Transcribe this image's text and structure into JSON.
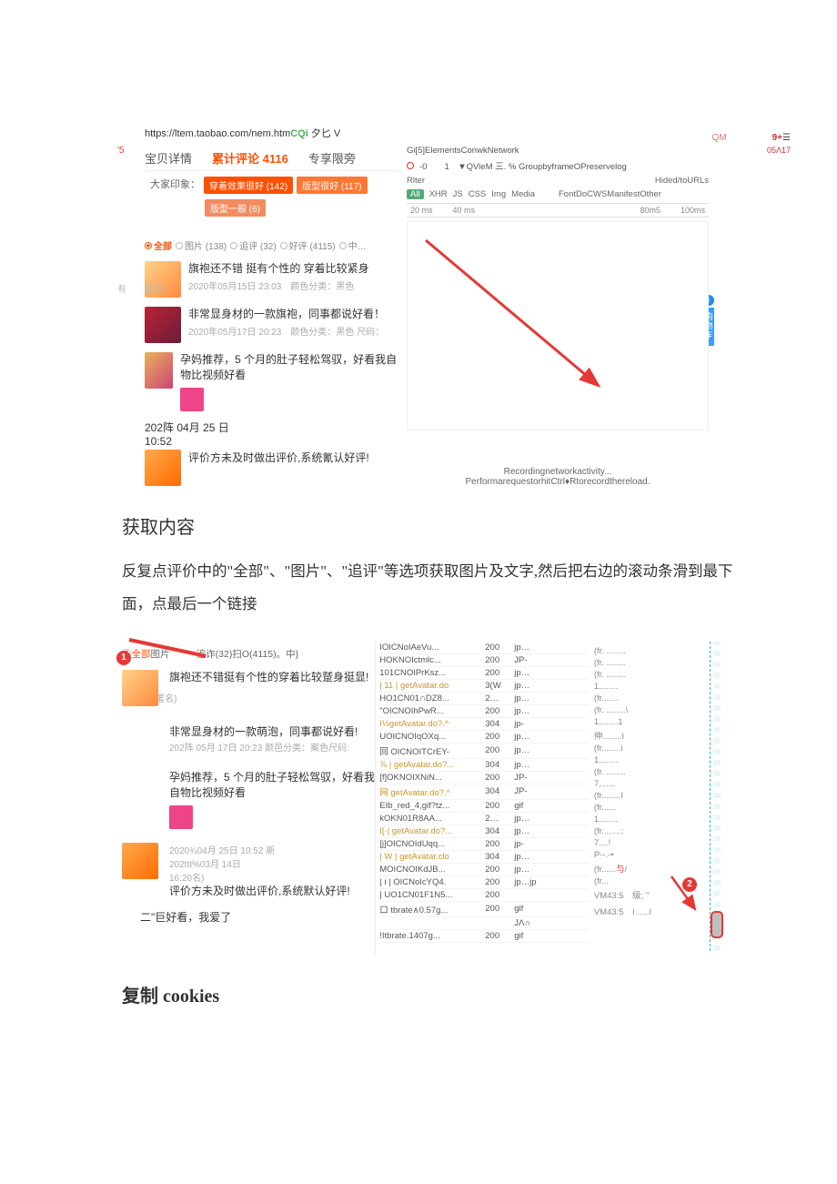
{
  "addr": {
    "url": "https://ltem.taobao.com/nem.htm",
    "suffix": "CQi",
    "tail": "夕匕 V"
  },
  "topright": {
    "qm": "QM",
    "nine": "9+",
    "ham": "☰",
    "sub": "05Λ17"
  },
  "n5": "'5",
  "tabs": {
    "t1": "宝贝详情",
    "t2": "累计评论",
    "t2_count": "4116",
    "t3": "专享限旁"
  },
  "impr_label": "大家印象：",
  "impr": {
    "b1": "穿着效果很好 (142)",
    "b2": "版型很好 (117)",
    "b3": "版型一般 (6)"
  },
  "filters": {
    "f1": "全部",
    "f2": "图片 (138)",
    "f3": "追评 (32)",
    "f4": "好评 (4115)",
    "f5": "中…"
  },
  "sidecart": "购物车",
  "reviews": [
    {
      "txt": "旗袍还不错 挺有个性的 穿着比较紧身",
      "meta": "2020年05月15日 23:03　颜色分类：黑色",
      "anon": "有　　匿名)"
    },
    {
      "txt": "非常显身材的一款旗袍，同事都说好看！",
      "meta": "2020年05月17日 20:23　颜色分类：黑色 尺码："
    },
    {
      "txt": "孕妈推荐，5 个月的肚子轻松驾驭，好看我自物比视频好看",
      "meta": ""
    },
    {
      "txt": "评价方未及时做出评价,系统氰认好评!",
      "meta": "202阵 04月 25 日\n10:52"
    }
  ],
  "devtools": {
    "tabs": "Gi[5]ElementsConwkNetwork",
    "toolrow": "-0　　1　▼QVieM 三.  % GroupbyframeOPreservelog",
    "filter": "Rlter",
    "hide": "Hided/toURLs",
    "types": [
      "All",
      "XHR",
      "JS",
      "CSS",
      "Img",
      "Media",
      "FontDoCWSManifestOther"
    ],
    "times": [
      "20 ms",
      "40 ms",
      "80m5",
      "100ms"
    ],
    "msg1": "Recordingnetworkactivity...",
    "msg2": "PerformarequestorhitCtrl♦Rtorecordthereload."
  },
  "section1_h": "获取内容",
  "section1_p": "反复点评价中的\"全部\"、\"图片\"、\"追评\"等选项获取图片及文字,然后把右边的滚动条滑到最下面，点最后一个链接",
  "shot2": {
    "filters": {
      "pre": "⑤",
      "act": "全部",
      "more": "图片",
      "right": "追诈(32)扫O(4115)。中}"
    },
    "badge1": "1",
    "anon": "有\"\"　　匿名)",
    "reviews": [
      {
        "txt": "旗袍还不错挺有个性的穿着比较蹵身挺显!",
        "meta": ""
      },
      {
        "txt": "非常显身材的一款萌泡，同事都说好看!",
        "meta": "202阵 05月 17日 20:23  颜邑分类：案色尺码:"
      },
      {
        "txt": "孕妈推荐，5 个月的肚子轻松驾驭，好看我自物比视频好看",
        "meta": ""
      },
      {
        "txt": "评价方未及时做出评价,系统默认好评!",
        "meta": "2020¾04月 25日 10:52 斯\n202ttt%03月 14日\n16:20名)"
      },
      {
        "txt": "二\"巨好看，我爱了",
        "meta": ""
      }
    ],
    "badge2": "2",
    "net": [
      {
        "nm": "IOICNoIAeVu...",
        "st": "200",
        "ty": "jp…",
        "wf": "(fr. ........"
      },
      {
        "nm": "HOKNOIctmlc...",
        "st": "200",
        "ty": "JP-",
        "wf": "(fr. ........"
      },
      {
        "nm": "101CNOIPrKsz...",
        "st": "200",
        "ty": "jp…",
        "wf": "(fr. ........"
      },
      {
        "nm": "| 11 | getAvatar.do",
        "st": "3(W",
        "ty": "jp…",
        "wf": "1........",
        "gold": true
      },
      {
        "nm": "HO1CN01∩DZ8...",
        "st": "2…",
        "ty": "jp…",
        "wf": "(fr......."
      },
      {
        "nm": "\"OICNOIhPwR...",
        "st": "200",
        "ty": "jp…",
        "wf": "(fr. ........\\"
      },
      {
        "nm": "I½getAvatar.do?.^",
        "st": "304",
        "ty": "jp-",
        "wf": "1........1",
        "gold": true
      },
      {
        "nm": "UOICNOIqOXq...",
        "st": "200",
        "ty": "jp…",
        "wf": "伸........I"
      },
      {
        "nm": "回 OICNOITCrEY-",
        "st": "200",
        "ty": "jp…",
        "wf": "(fr........i"
      },
      {
        "nm": "  ⅞ | getAvatar.do?...",
        "st": "304",
        "ty": "jp…",
        "wf": "1........",
        "gold": true
      },
      {
        "nm": "[f]OKNOIXNiN...",
        "st": "200",
        "ty": "JP-",
        "wf": "(fr. ........"
      },
      {
        "nm": "网 getAvatar.do?.^",
        "st": "304",
        "ty": "JP-",
        "wf": "7,......",
        "gold": true
      },
      {
        "nm": "EIb_red_4,gif?tz...",
        "st": "200",
        "ty": "gif",
        "wf": "(fr........I"
      },
      {
        "nm": "kOKN01R8AA...",
        "st": "2…",
        "ty": "jp…",
        "wf": "(fr......"
      },
      {
        "nm": "I[·|  getAvatar.do?...",
        "st": "304",
        "ty": "jp…",
        "wf": "1........",
        "gold": true
      },
      {
        "nm": "[j]OICNOIdUqq...",
        "st": "200",
        "ty": "jp-",
        "wf": "(fr........;"
      },
      {
        "nm": "| W | getAvatar.clo",
        "st": "304",
        "ty": "jp…",
        "wf": "7....!",
        "gold": true
      },
      {
        "nm": "MOICNOIKdJB...",
        "st": "200",
        "ty": "jp…",
        "wf": "P--.-•"
      },
      {
        "nm": "| i | OICNoIcYQ4.",
        "st": "200",
        "ty": "jp…jp",
        "wf": "(fr......与/"
      },
      {
        "nm": "| UO1CN01F1N5...",
        "st": "200",
        "ty": "",
        "wf": "(fr..."
      },
      {
        "nm": "口 tbrate∧0.57g...",
        "st": "200",
        "ty": "gif",
        "wf": "VM43:5　级; \""
      },
      {
        "nm": "",
        "st": "",
        "ty": "JΛ∩",
        "wf": ""
      },
      {
        "nm": "!Itbrate.1407g...",
        "st": "200",
        "ty": "gif",
        "wf": "VM43:5　I......I"
      }
    ]
  },
  "section2_h": "复制 cookies"
}
